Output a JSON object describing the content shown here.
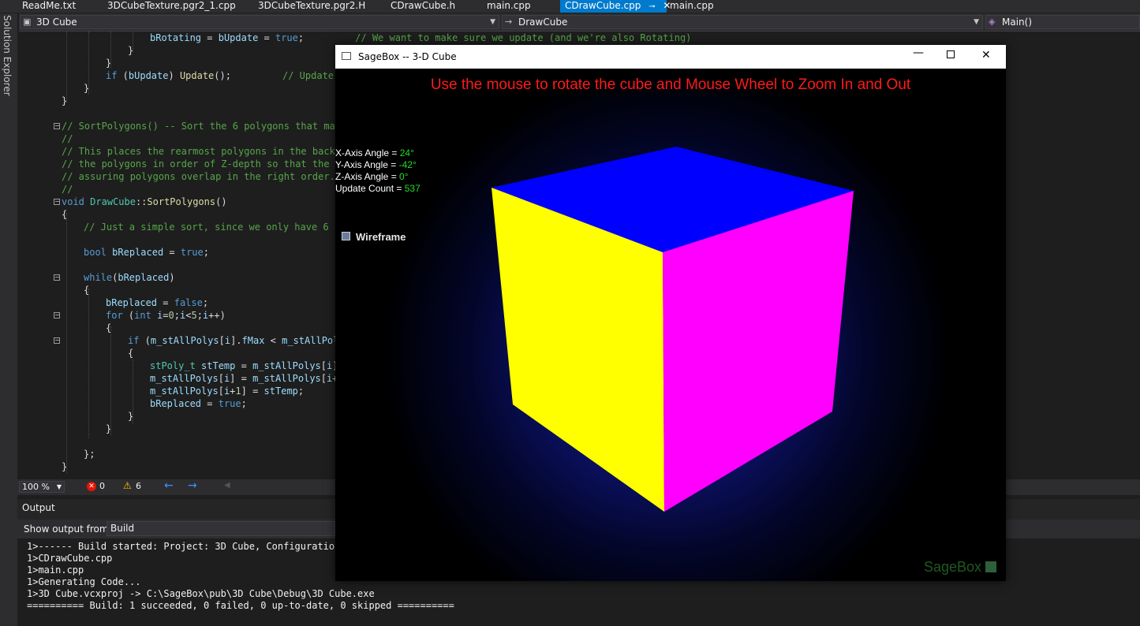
{
  "tabs": [
    {
      "label": "ReadMe.txt",
      "active": false
    },
    {
      "label": "3DCubeTexture.pgr2_1.cpp",
      "active": false
    },
    {
      "label": "3DCubeTexture.pgr2.H",
      "active": false
    },
    {
      "label": "CDrawCube.h",
      "active": false
    },
    {
      "label": "main.cpp",
      "active": false
    },
    {
      "label": "CDrawCube.cpp",
      "active": true
    },
    {
      "label": "main.cpp",
      "active": false
    }
  ],
  "nav": {
    "project": "3D Cube",
    "scope": "DrawCube",
    "member": "Main()"
  },
  "side_label": "Solution Explorer",
  "code_visible": [
    "bRotating = bUpdate = true;         // We want to make sure we update (and we're also Rotating)",
    "}",
    "}",
    "if (bUpdate) Update();         // Update it",
    "}",
    "}",
    "// SortPolygons() -- Sort the 6 polygons that make",
    "//",
    "// This places the rearmost polygons in the back,",
    "// the polygons in order of Z-depth so that the fr",
    "// assuring polygons overlap in the right order.",
    "//",
    "void DrawCube::SortPolygons()",
    "{",
    "// Just a simple sort, since we only have 6 po",
    "bool bReplaced = true;",
    "while(bReplaced)",
    "{",
    "bReplaced = false;",
    "for (int i=0;i<5;i++)",
    "{",
    "if (m_stAllPolys[i].fMax < m_stAllPoly",
    "{",
    "stPoly_t stTemp = m_stAllPolys[i];",
    "m_stAllPolys[i] = m_stAllPolys[i+1",
    "m_stAllPolys[i+1] = stTemp;",
    "bReplaced = true;",
    "}",
    "}",
    "};",
    "}"
  ],
  "editor_status": {
    "zoom": "100 %",
    "errors": "0",
    "warnings": "6"
  },
  "output": {
    "title": "Output",
    "show_from_label": "Show output from:",
    "source": "Build",
    "lines": [
      "1>------ Build started: Project: 3D Cube, Configuration:",
      "1>CDrawCube.cpp",
      "1>main.cpp",
      "1>Generating Code...",
      "1>3D Cube.vcxproj -> C:\\SageBox\\pub\\3D Cube\\Debug\\3D Cube.exe",
      "========== Build: 1 succeeded, 0 failed, 0 up-to-date, 0 skipped =========="
    ]
  },
  "sagebox": {
    "window_title": "SageBox -- 3-D Cube",
    "instruction": "Use the mouse to rotate the cube and Mouse Wheel to Zoom In and Out",
    "instruction_color": "#ff1a1a",
    "stats": [
      {
        "label": "X-Axis Angle = ",
        "value": "24°"
      },
      {
        "label": "Y-Axis Angle = ",
        "value": "-42°"
      },
      {
        "label": "Z-Axis Angle = ",
        "value": "0°"
      },
      {
        "label": "Update Count = ",
        "value": "537"
      }
    ],
    "stats_value_color": "#22dd22",
    "wireframe_label": "Wireframe",
    "wireframe_checked": false,
    "brand": "SageBox",
    "face_colors": {
      "top": "#0000ff",
      "left": "#ffff00",
      "right": "#ff00ff"
    }
  }
}
